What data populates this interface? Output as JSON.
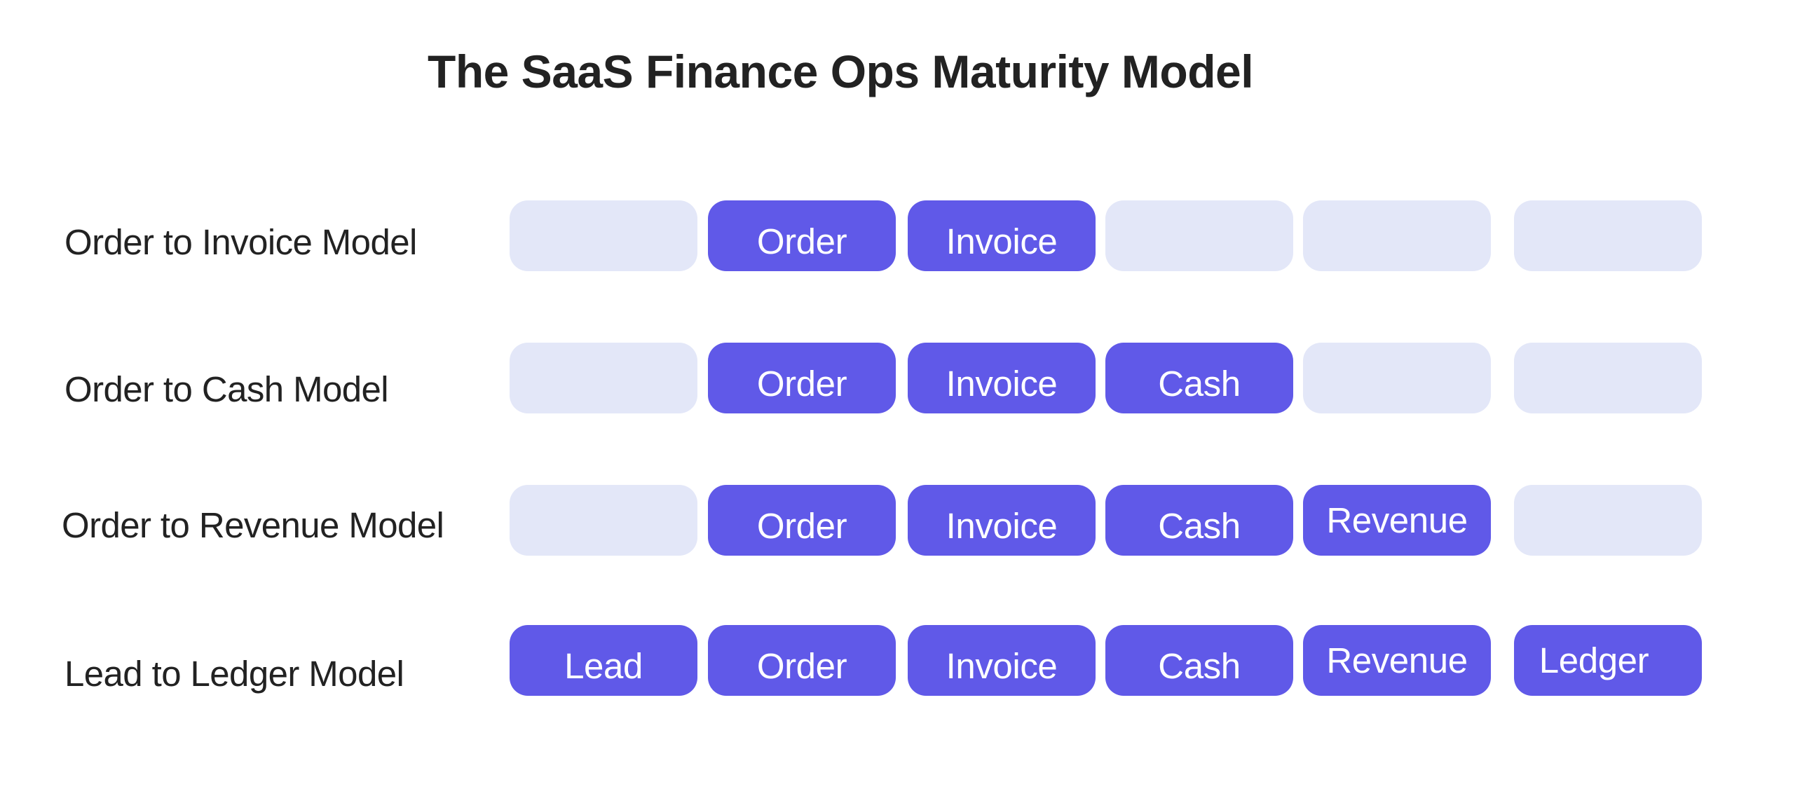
{
  "title": "The SaaS Finance Ops Maturity Model",
  "colors": {
    "filled": "#6059E8",
    "empty": "#E3E7F8",
    "text": "#222222",
    "cell_text": "#FFFFFF"
  },
  "stages": [
    "Lead",
    "Order",
    "Invoice",
    "Cash",
    "Revenue",
    "Ledger"
  ],
  "rows": [
    {
      "label": "Order to Invoice Model",
      "cells": [
        "",
        "Order",
        "Invoice",
        "",
        "",
        ""
      ]
    },
    {
      "label": "Order to Cash Model",
      "cells": [
        "",
        "Order",
        "Invoice",
        "Cash",
        "",
        ""
      ]
    },
    {
      "label": "Order to Revenue Model",
      "cells": [
        "",
        "Order",
        "Invoice",
        "Cash",
        "Revenue",
        ""
      ]
    },
    {
      "label": "Lead to Ledger Model",
      "cells": [
        "Lead",
        "Order",
        "Invoice",
        "Cash",
        "Revenue",
        "Ledger"
      ]
    }
  ]
}
